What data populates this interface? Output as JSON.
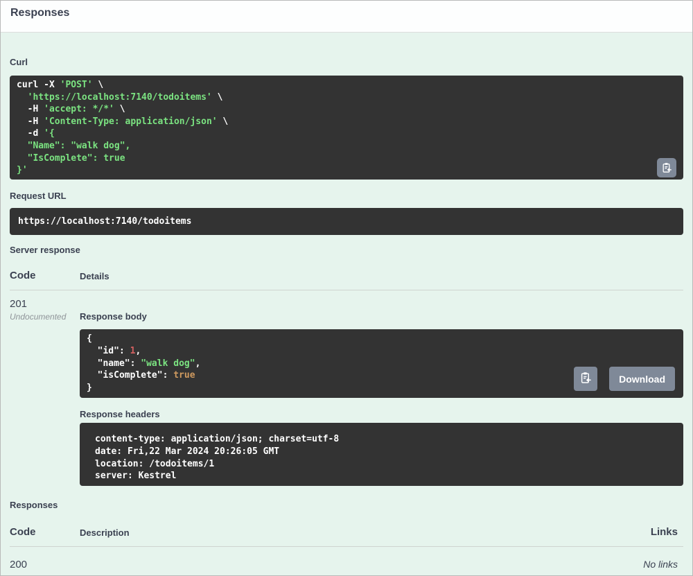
{
  "panel": {
    "title": "Responses"
  },
  "request_section": {
    "curl_label": "Curl",
    "request_url_label": "Request URL",
    "server_response_label": "Server response"
  },
  "code_blocks": {
    "curl": [
      [
        [
          "plain",
          "curl -X "
        ],
        [
          "str",
          "'POST'"
        ],
        [
          "plain",
          " \\"
        ]
      ],
      [
        [
          "plain",
          "  "
        ],
        [
          "str",
          "'https://localhost:7140/todoitems'"
        ],
        [
          "plain",
          " \\"
        ]
      ],
      [
        [
          "plain",
          "  -H "
        ],
        [
          "str",
          "'accept: */*'"
        ],
        [
          "plain",
          " \\"
        ]
      ],
      [
        [
          "plain",
          "  -H "
        ],
        [
          "str",
          "'Content-Type: application/json'"
        ],
        [
          "plain",
          " \\"
        ]
      ],
      [
        [
          "plain",
          "  -d "
        ],
        [
          "str",
          "'{"
        ]
      ],
      [
        [
          "str",
          "  \"Name\": \"walk dog\","
        ]
      ],
      [
        [
          "str",
          "  \"IsComplete\": true"
        ]
      ],
      [
        [
          "str",
          "}'"
        ]
      ]
    ],
    "request_url": [
      [
        [
          "plain",
          "https://localhost:7140/todoitems"
        ]
      ]
    ],
    "response_body": [
      [
        [
          "plain",
          "{"
        ]
      ],
      [
        [
          "plain",
          "  \"id\": "
        ],
        [
          "num",
          "1"
        ],
        [
          "plain",
          ","
        ]
      ],
      [
        [
          "plain",
          "  \"name\": "
        ],
        [
          "str",
          "\"walk dog\""
        ],
        [
          "plain",
          ","
        ]
      ],
      [
        [
          "plain",
          "  \"isComplete\": "
        ],
        [
          "bool",
          "true"
        ]
      ],
      [
        [
          "plain",
          "}"
        ]
      ]
    ],
    "response_headers": [
      [
        [
          "plain",
          "content-type: application/json; charset=utf-8"
        ]
      ],
      [
        [
          "plain",
          "date: Fri,22 Mar 2024 20:26:05 GMT"
        ]
      ],
      [
        [
          "plain",
          "location: /todoitems/1"
        ]
      ],
      [
        [
          "plain",
          "server: Kestrel"
        ]
      ]
    ]
  },
  "server_response_table": {
    "code_header": "Code",
    "details_header": "Details",
    "row": {
      "code": "201",
      "badge": "Undocumented",
      "response_body_label": "Response body",
      "download_label": "Download",
      "response_headers_label": "Response headers"
    }
  },
  "responses_table": {
    "section_label": "Responses",
    "code_header": "Code",
    "description_header": "Description",
    "links_header": "Links",
    "rows": [
      {
        "code": "200",
        "description": "",
        "links": "No links"
      }
    ]
  },
  "colors": {
    "section_bg": "#e6f4ed",
    "code_bg": "#333333",
    "text": "#3b4151",
    "muted": "#8f9499",
    "button_bg": "#7f8998",
    "token_string": "#7be381",
    "token_number": "#d36060",
    "token_boolean": "#cf9a5f"
  }
}
